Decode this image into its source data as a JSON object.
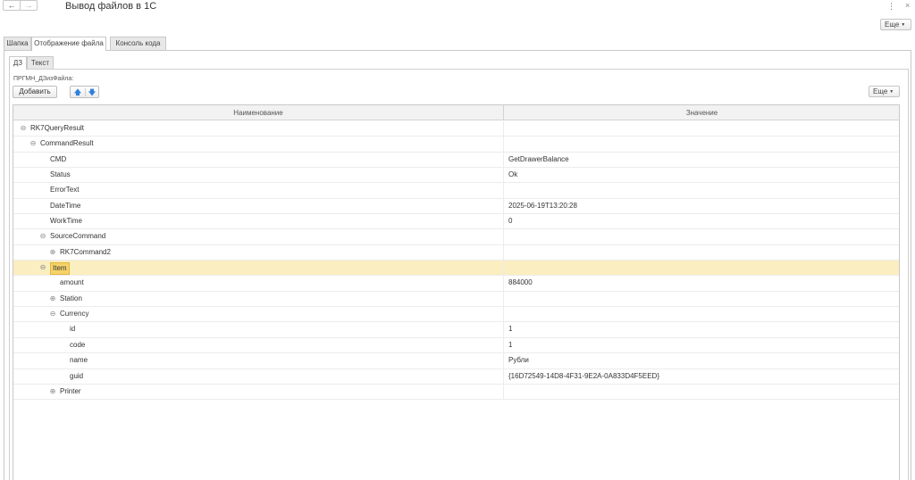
{
  "titlebar": {
    "back_icon": "←",
    "forward_icon": "→",
    "title": "Вывод файлов в 1С",
    "menu_icon": "⋮",
    "close_icon": "×"
  },
  "toolbar": {
    "more_label": "Еще"
  },
  "main_tabs": [
    "Шапка",
    "Отображение файла",
    "Консоль кода"
  ],
  "sub_tabs": [
    "ДЗ",
    "Текст"
  ],
  "attribute_label": "ПРГМН_ДЗизФайла:",
  "table_toolbar": {
    "add_label": "Добавить",
    "up_icon": "🡅",
    "down_icon": "🡇",
    "more_label": "Еще"
  },
  "table": {
    "columns": [
      "Наименование",
      "Значение"
    ],
    "rows": [
      {
        "name": "RK7QueryResult",
        "value": "",
        "level": 0,
        "toggle": "⊖"
      },
      {
        "name": "CommandResult",
        "value": "",
        "level": 1,
        "toggle": "⊖"
      },
      {
        "name": "CMD",
        "value": "GetDrawerBalance",
        "level": 2,
        "toggle": ""
      },
      {
        "name": "Status",
        "value": "Ok",
        "level": 2,
        "toggle": ""
      },
      {
        "name": "ErrorText",
        "value": "",
        "level": 2,
        "toggle": ""
      },
      {
        "name": "DateTime",
        "value": "2025-06-19T13:20:28",
        "level": 2,
        "toggle": ""
      },
      {
        "name": "WorkTime",
        "value": "0",
        "level": 2,
        "toggle": ""
      },
      {
        "name": "SourceCommand",
        "value": "",
        "level": 2,
        "toggle": "⊖"
      },
      {
        "name": "RK7Command2",
        "value": "",
        "level": 3,
        "toggle": "⊕"
      },
      {
        "name": "Item",
        "value": "",
        "level": 2,
        "toggle": "⊖",
        "selected": true
      },
      {
        "name": "amount",
        "value": "884000",
        "level": 3,
        "toggle": ""
      },
      {
        "name": "Station",
        "value": "",
        "level": 3,
        "toggle": "⊕"
      },
      {
        "name": "Currency",
        "value": "",
        "level": 3,
        "toggle": "⊖"
      },
      {
        "name": "id",
        "value": "1",
        "level": 4,
        "toggle": ""
      },
      {
        "name": "code",
        "value": "1",
        "level": 4,
        "toggle": ""
      },
      {
        "name": "name",
        "value": "Рубли",
        "level": 4,
        "toggle": ""
      },
      {
        "name": "guid",
        "value": "{16D72549-14D8-4F31-9E2A-0A833D4F5EED}",
        "level": 4,
        "toggle": ""
      },
      {
        "name": "Printer",
        "value": "",
        "level": 3,
        "toggle": "⊕"
      }
    ]
  }
}
